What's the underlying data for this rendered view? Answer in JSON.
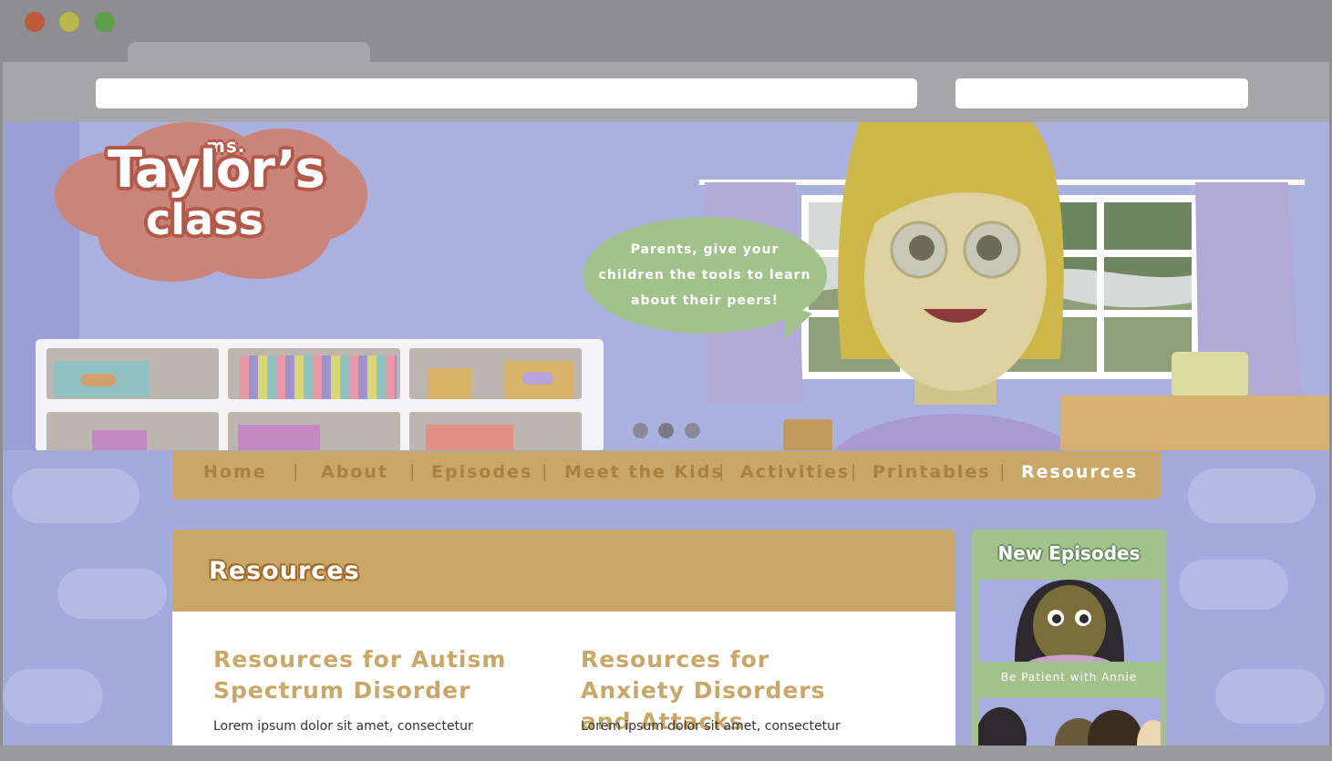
{
  "browser": {
    "url": "",
    "search": ""
  },
  "site": {
    "logo": {
      "line1": "ms.",
      "line2": "Taylor’s",
      "line3": "class"
    },
    "speech_bubble": [
      "Parents, give your",
      "children the tools to learn",
      "about their peers!"
    ]
  },
  "nav": {
    "items": [
      {
        "label": "Home"
      },
      {
        "label": "About"
      },
      {
        "label": "Episodes"
      },
      {
        "label": "Meet the Kids"
      },
      {
        "label": "Activities"
      },
      {
        "label": "Printables"
      },
      {
        "label": "Resources",
        "active": true
      }
    ],
    "separator": "|"
  },
  "carousel": {
    "count": 3,
    "active_index": 1
  },
  "main": {
    "title": "Resources",
    "resources": [
      {
        "heading": "Resources for Autism Spectrum Disorder",
        "excerpt": "Lorem ipsum dolor sit amet, consectetur"
      },
      {
        "heading": "Resources for Anxiety Disorders and Attacks",
        "excerpt": "Lorem ipsum dolor sit amet, consectetur"
      }
    ]
  },
  "sidebar": {
    "title": "New Episodes",
    "episodes": [
      {
        "caption": "Be Patient with Annie"
      },
      {
        "caption": ""
      }
    ]
  },
  "colors": {
    "wall": "#abb1df",
    "nav": "#c9a767",
    "accent_text": "#c9a767",
    "bubble": "#a2c28c",
    "logo_cloud": "#c9857a"
  }
}
